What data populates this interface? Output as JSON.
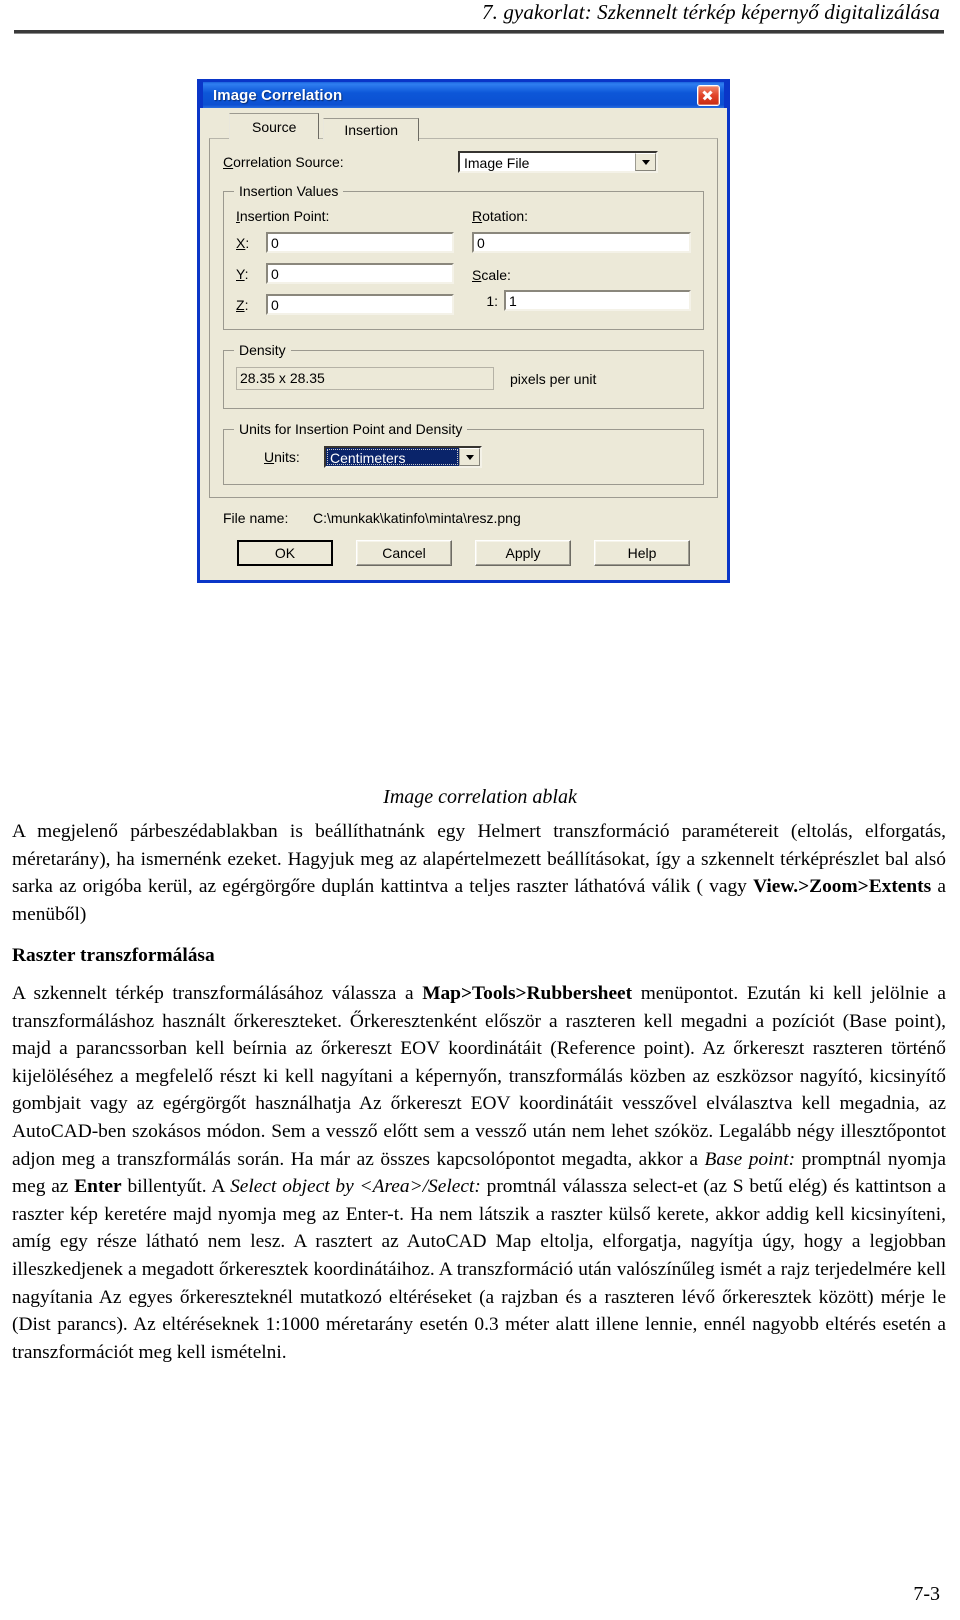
{
  "header": {
    "title": "7. gyakorlat: Szkennelt térkép képernyő digitalizálása"
  },
  "dialog": {
    "title": "Image Correlation",
    "close_icon": "close-icon",
    "tabs": [
      {
        "label": "Source",
        "active": true
      },
      {
        "label": "Insertion",
        "active": false
      }
    ],
    "correlation_source": {
      "label": "Correlation Source:",
      "value": "Image File"
    },
    "insertion_values": {
      "legend": "Insertion Values",
      "insertion_point_label": "Insertion Point:",
      "rotation_label": "Rotation:",
      "scale_label": "Scale:",
      "scale_prefix": "1:",
      "x_label": "X:",
      "y_label": "Y:",
      "z_label": "Z:",
      "x_value": "0",
      "y_value": "0",
      "z_value": "0",
      "rotation_value": "0",
      "scale_value": "1"
    },
    "density": {
      "legend": "Density",
      "value": "28.35 x 28.35",
      "unit_label": "pixels per unit"
    },
    "units_group": {
      "legend": "Units for Insertion Point and Density",
      "units_label": "Units:",
      "units_value": "Centimeters"
    },
    "file": {
      "label": "File name:",
      "value": "C:\\munkak\\katinfo\\minta\\resz.png"
    },
    "buttons": {
      "ok": "OK",
      "cancel": "Cancel",
      "apply": "Apply",
      "help": "Help"
    },
    "colors": {
      "titlebar": "#0c50d2",
      "border": "#0a36c8",
      "face": "#ece9d8",
      "selection": "#0a246a",
      "close": "#c62a12"
    }
  },
  "figure_caption": "Image correlation ablak",
  "body": {
    "para1_a": "A megjelenő párbeszédablakban is beállíthatnánk egy Helmert transzformáció paramétereit (eltolás, elforgatás, méretarány), ha ismernénk ezeket. Hagyjuk meg az alapértelmezett beállításokat, így a szkennelt térképrészlet bal alsó sarka az origóba kerül, az egérgörgőre duplán kattintva a teljes raszter láthatóvá válik ( vagy ",
    "para1_bold": "View.>Zoom>Extents",
    "para1_b": " a menüből)",
    "heading": "Raszter transzformálása",
    "para2_a": "A szkennelt térkép transzformálásához válassza a ",
    "para2_bold1": "Map>Tools>Rubbersheet",
    "para2_b": " menüpontot. Ezután ki kell jelölnie a transzformáláshoz használt őrkereszteket. Őrkeresztenként először a raszteren kell megadni a pozíciót (Base point), majd a parancssorban kell beírnia az őrkereszt EOV koordinátáit (Reference point). Az őrkereszt raszteren történő kijelöléséhez a megfelelő részt ki kell nagyítani a képernyőn, transzformálás közben az eszközsor nagyító, kicsinyítő gombjait vagy az egérgörgőt használhatja Az őrkereszt EOV koordinátáit vesszővel elválasztva kell megadnia, az AutoCAD-ben szokásos módon. Sem a vessző előtt sem a vessző után nem lehet szóköz. Legalább négy illesztőpontot adjon meg a transzformálás során. Ha már az összes kapcsolópontot megadta, akkor a ",
    "para2_italic1": "Base point:",
    "para2_c": " promptnál nyomja meg az ",
    "para2_bold2": "Enter",
    "para2_d": " billentyűt. A ",
    "para2_italic2": "Select object by <Area>/Select:",
    "para2_e": " promtnál válassza select-et (az S betű elég) és kattintson a raszter kép keretére majd nyomja meg az Enter-t. Ha nem látszik a raszter külső kerete, akkor addig kell kicsinyíteni, amíg egy része látható nem lesz. A rasztert az AutoCAD Map eltolja, elforgatja, nagyítja úgy, hogy a legjobban illeszkedjenek a megadott őrkeresztek koordinátáihoz. A transzformáció után valószínűleg ismét a rajz terjedelmére kell nagyítania Az egyes őrkereszteknél mutatkozó eltéréseket (a rajzban és a raszteren lévő őrkeresztek között) mérje le (Dist parancs). Az eltéréseknek 1:1000 méretarány esetén 0.3 méter alatt illene lennie, ennél nagyobb eltérés esetén a transzformációt meg kell ismételni."
  },
  "page_number": "7-3"
}
